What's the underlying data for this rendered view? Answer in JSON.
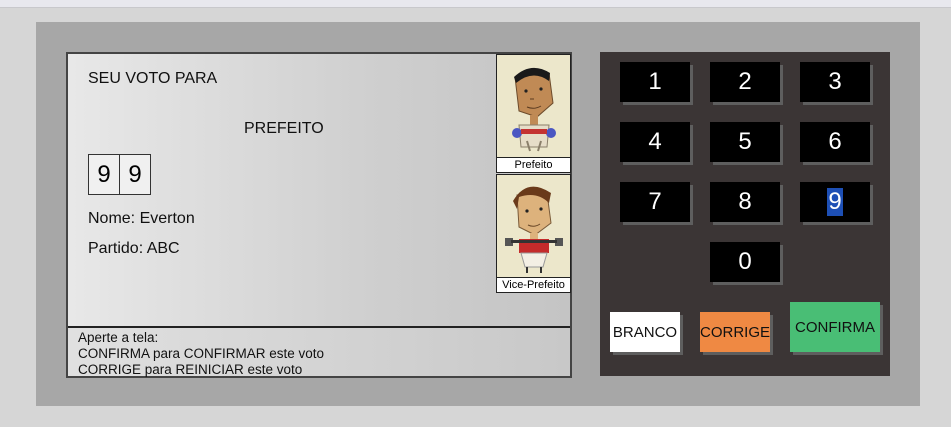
{
  "screen": {
    "header": "SEU VOTO PARA",
    "office": "PREFEITO",
    "digits": [
      "9",
      "9"
    ],
    "name": "Nome: Everton",
    "party": "Partido: ABC",
    "photos": {
      "mayor_caption": "Prefeito",
      "vice_caption": "Vice-Prefeito"
    },
    "footer": {
      "line1": "Aperte a tela:",
      "line2": "CONFIRMA para CONFIRMAR este voto",
      "line3": "CORRIGE para REINICIAR este voto"
    }
  },
  "keypad": {
    "keys": [
      "1",
      "2",
      "3",
      "4",
      "5",
      "6",
      "7",
      "8",
      "9",
      "0"
    ],
    "selected_key": "9",
    "branco": "BRANCO",
    "corrige": "CORRIGE",
    "confirma": "CONFIRMA",
    "colors": {
      "branco": "#ffffff",
      "corrige": "#ef8943",
      "confirma": "#49be75",
      "selection": "#1d4fb5"
    }
  }
}
